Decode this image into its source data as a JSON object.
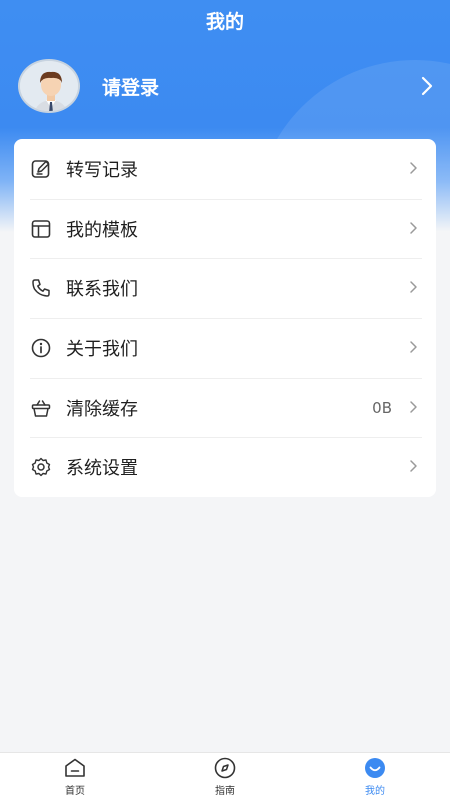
{
  "header": {
    "title": "我的"
  },
  "profile": {
    "login_label": "请登录"
  },
  "menu": {
    "items": [
      {
        "label": "转写记录",
        "icon": "edit-note-icon"
      },
      {
        "label": "我的模板",
        "icon": "template-icon"
      },
      {
        "label": "联系我们",
        "icon": "phone-icon"
      },
      {
        "label": "关于我们",
        "icon": "info-icon"
      },
      {
        "label": "清除缓存",
        "icon": "basket-icon",
        "value": "0B"
      },
      {
        "label": "系统设置",
        "icon": "gear-icon"
      }
    ]
  },
  "tabbar": {
    "tabs": [
      {
        "label": "首页",
        "icon": "home-icon",
        "active": false
      },
      {
        "label": "指南",
        "icon": "compass-icon",
        "active": false
      },
      {
        "label": "我的",
        "icon": "smile-icon",
        "active": true
      }
    ]
  },
  "colors": {
    "primary": "#3c8af1",
    "background": "#f4f5f7",
    "text": "#1f1f1f"
  }
}
